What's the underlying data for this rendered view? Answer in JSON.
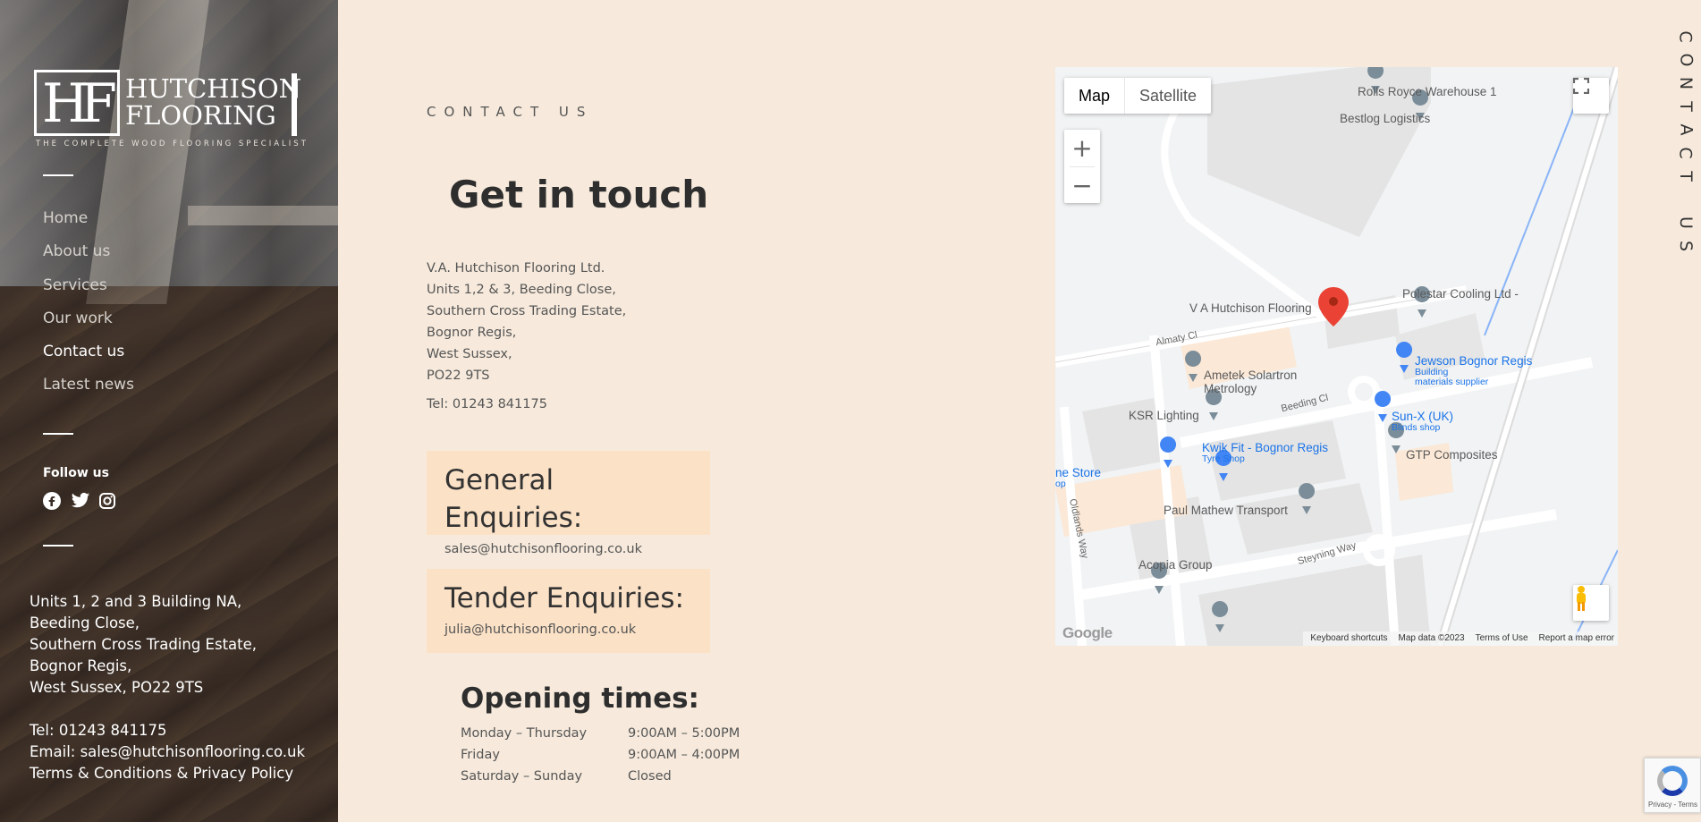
{
  "brand": {
    "name_line1": "HUTCHISON",
    "name_line2": "FLOORING",
    "monogram": "HF",
    "tagline": "THE COMPLETE WOOD FLOORING SPECIALIST"
  },
  "nav": {
    "items": [
      {
        "label": "Home",
        "active": false
      },
      {
        "label": "About us",
        "active": false
      },
      {
        "label": "Services",
        "active": false
      },
      {
        "label": "Our work",
        "active": false
      },
      {
        "label": "Contact us",
        "active": true
      },
      {
        "label": "Latest news",
        "active": false
      }
    ]
  },
  "social": {
    "title": "Follow us",
    "icons": [
      "facebook-icon",
      "twitter-icon",
      "instagram-icon"
    ]
  },
  "sidebar_address": {
    "lines": [
      "Units 1, 2 and 3 Building NA,",
      "Beeding Close,",
      "Southern Cross Trading Estate,",
      "Bognor Regis,",
      "West Sussex, PO22 9TS"
    ],
    "tel": "Tel: 01243 841175",
    "email": "Email: sales@hutchisonflooring.co.uk",
    "terms": "Terms & Conditions & Privacy Policy"
  },
  "main": {
    "eyebrow": "CONTACT US",
    "heading": "Get in touch",
    "address_lines": [
      "V.A. Hutchison Flooring Ltd.",
      "Units 1,2 & 3, Beeding Close,",
      "Southern Cross Trading Estate,",
      "Bognor Regis,",
      "West Sussex,",
      "PO22 9TS"
    ],
    "tel": "Tel: 01243 841175",
    "cards": [
      {
        "title": "General Enquiries:",
        "email": "sales@hutchisonflooring.co.uk"
      },
      {
        "title": "Tender Enquiries:",
        "email": "julia@hutchisonflooring.co.uk"
      }
    ],
    "hours_title": "Opening times:",
    "hours": [
      {
        "day": "Monday – Thursday",
        "time": "9:00AM – 5:00PM"
      },
      {
        "day": "Friday",
        "time": "9:00AM – 4:00PM"
      },
      {
        "day": "Saturday – Sunday",
        "time": "Closed"
      }
    ]
  },
  "vertical_title": "CONTACT US",
  "map": {
    "type_map": "Map",
    "type_satellite": "Satellite",
    "zoom_in": "+",
    "zoom_out": "−",
    "google": "Google",
    "footer": [
      "Keyboard shortcuts",
      "Map data ©2023",
      "Terms of Use",
      "Report a map error"
    ],
    "places": [
      "Rolls Royce Warehouse 1",
      "Bestlog Logistics",
      "V A Hutchison Flooring",
      "Polestar Cooling Ltd -",
      "Jewson Bognor Regis",
      "Building",
      "materials supplier",
      "Ametek Solartron",
      "Metrology",
      "KSR Lighting",
      "Sun-X (UK)",
      "Blinds shop",
      "Kwik Fit - Bognor Regis",
      "Tyre Shop",
      "GTP Composites",
      "ne Store",
      "op",
      "Paul Mathew Transport",
      "Acopia Group"
    ],
    "roads": [
      "Almaty Cl",
      "Beeding Cl",
      "Oldlands Way",
      "Steyning Way"
    ]
  },
  "recaptcha": {
    "text": "Privacy - Terms"
  }
}
